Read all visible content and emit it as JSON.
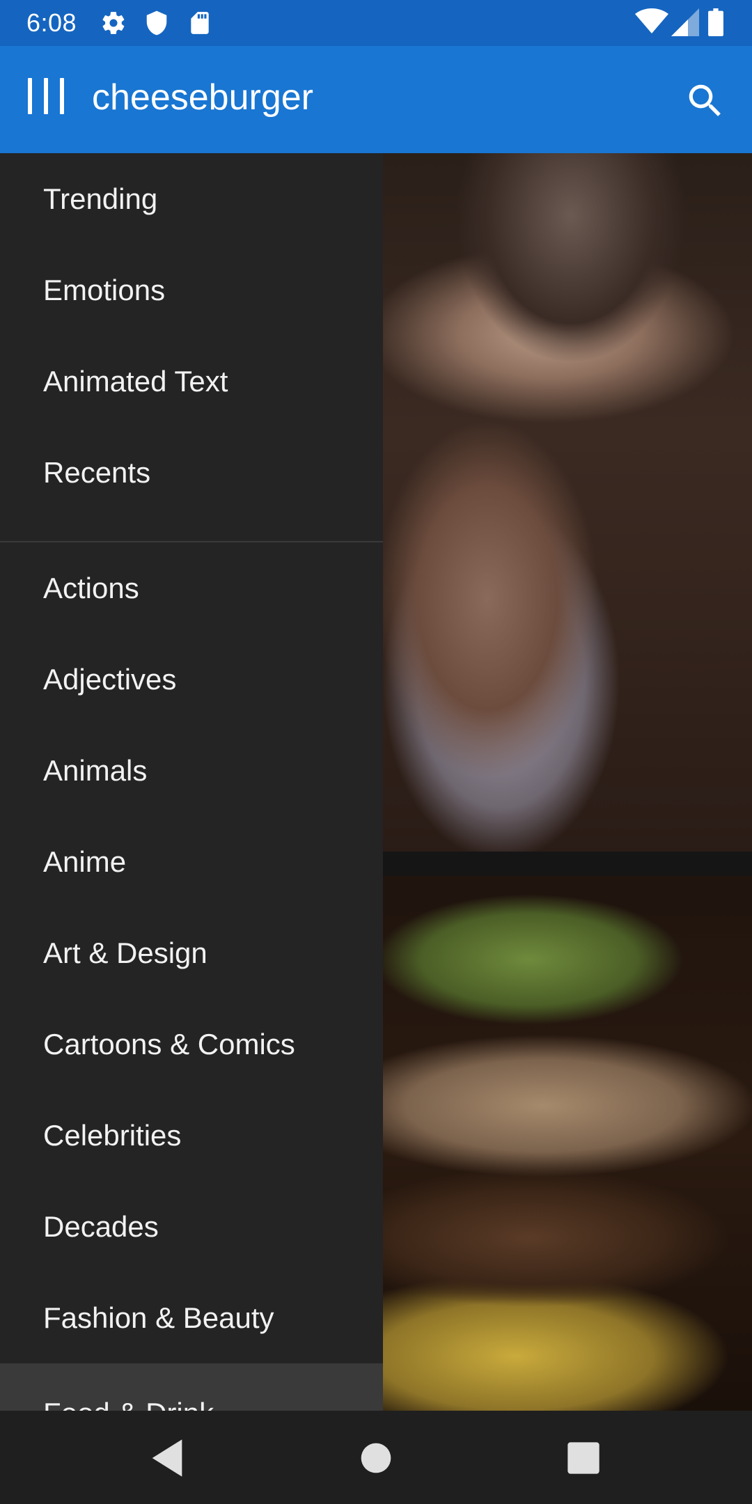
{
  "status_bar": {
    "time": "6:08",
    "left_icons": [
      "gear-icon",
      "shield-icon",
      "sd-card-icon"
    ],
    "right_icons": [
      "wifi-icon",
      "cell-signal-icon",
      "battery-icon"
    ]
  },
  "app_bar": {
    "menu_icon": "menu-icon",
    "query": "cheeseburger",
    "search_icon": "search-icon",
    "background": "#1976d2",
    "status_background": "#1565c0"
  },
  "drawer": {
    "primary_items": [
      {
        "label": "Trending"
      },
      {
        "label": "Emotions"
      },
      {
        "label": "Animated Text"
      },
      {
        "label": "Recents"
      }
    ],
    "category_items": [
      {
        "label": "Actions"
      },
      {
        "label": "Adjectives"
      },
      {
        "label": "Animals"
      },
      {
        "label": "Anime"
      },
      {
        "label": "Art & Design"
      },
      {
        "label": "Cartoons & Comics"
      },
      {
        "label": "Celebrities"
      },
      {
        "label": "Decades"
      },
      {
        "label": "Fashion & Beauty"
      },
      {
        "label": "Food & Drink"
      }
    ],
    "background": "#242424"
  },
  "nav_bar": {
    "buttons": [
      "back-icon",
      "home-icon",
      "recents-icon"
    ]
  }
}
